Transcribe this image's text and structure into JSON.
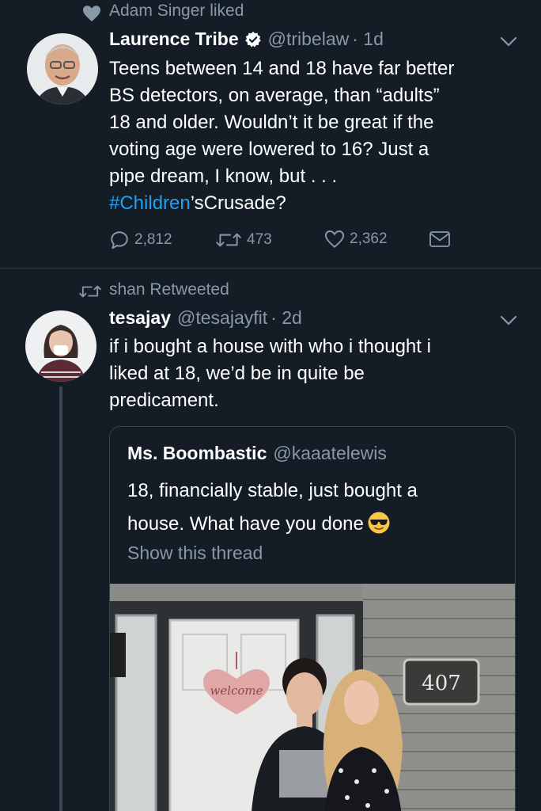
{
  "tweet1": {
    "context_text": "Adam Singer liked",
    "name": "Laurence Tribe",
    "handle": "@tribelaw",
    "time": "· 1d",
    "lines": [
      "Teens between 14 and 18 have far better",
      "BS detectors, on average, than “adults”",
      "18 and older. Wouldn’t it be great if the",
      "voting age were lowered to 16? Just a",
      "pipe dream, I know, but . . ."
    ],
    "hashtag": "#Children",
    "hashtag_suffix": "’sCrusade?",
    "replies": "2,812",
    "retweets": "473",
    "likes": "2,362"
  },
  "tweet2": {
    "context_text": "shan Retweeted",
    "name": "tesajay",
    "handle": "@tesajayfit",
    "time": "· 2d",
    "lines": [
      "if i bought a house with who i thought i",
      "liked at 18, we’d be in quite be",
      "predicament."
    ],
    "quote": {
      "name": "Ms. Boombastic",
      "handle": "@kaaatelewis",
      "line1": "18, financially stable, just bought a",
      "line2": "house. What have you done",
      "show_thread": "Show this thread",
      "photo_sign": "welcome",
      "house_number": "407"
    }
  },
  "colors": {
    "background": "#141d26",
    "secondary_text": "#8899a6",
    "link": "#1da1f2",
    "divider": "#38444d"
  }
}
